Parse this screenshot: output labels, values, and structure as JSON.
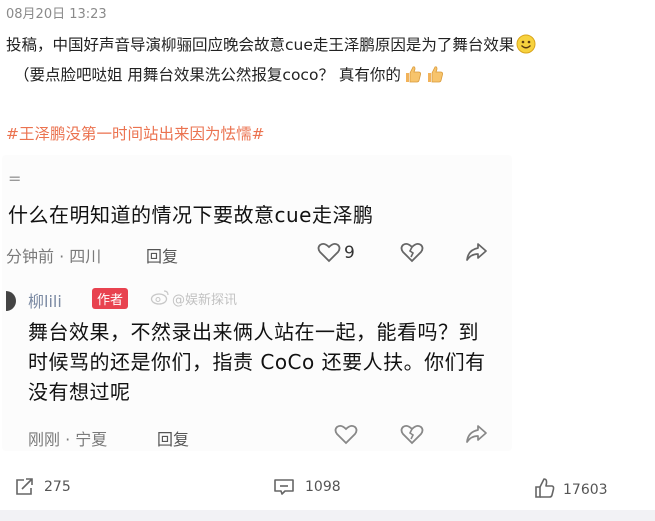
{
  "post": {
    "timestamp": "08月20日 13:23",
    "line1": "投稿，中国好声音导演柳骊回应晚会故意cue走王泽鹏原因是为了舞台效果",
    "line2": "（要点脸吧哒姐 用舞台效果洗公然报复coco？ 真有你的",
    "hashtag": "#王泽鹏没第一时间站出来因为怯懦#",
    "emoji_1": "smile-emoji",
    "emoji_2": "thumbs-up-emoji"
  },
  "screenshot": {
    "header_mark": "=",
    "comment1": {
      "text": "什么在明知道的情况下要故意cue走泽鹏",
      "meta": "分钟前 · 四川",
      "reply": "回复",
      "likes": "9"
    },
    "comment2": {
      "username": "柳lili",
      "badge": "作者",
      "watermark": "@娱新探讯",
      "text": "舞台效果，不然录出来俩人站在一起，能看吗？到时候骂的还是你们，指责 CoCo 还要人扶。你们有没有想过呢",
      "meta": "刚刚 · 宁夏",
      "reply": "回复"
    }
  },
  "actions": {
    "repost_count": "275",
    "comment_count": "1098",
    "like_count": "17603"
  },
  "colors": {
    "hashtag": "#eb7350",
    "badge": "#e8424f",
    "username": "#7b8aa3"
  }
}
